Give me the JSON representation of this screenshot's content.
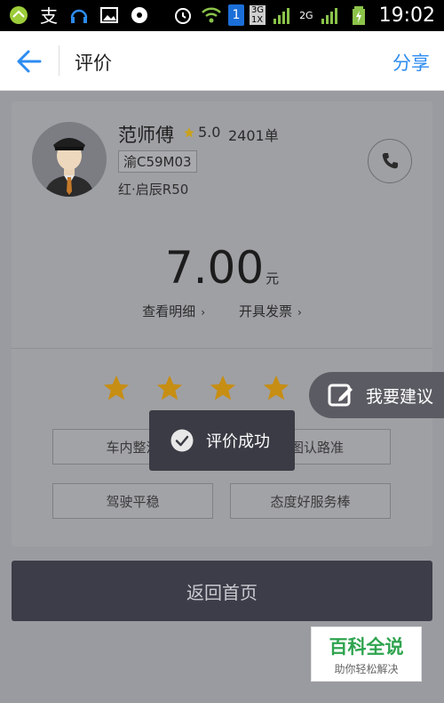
{
  "status_bar": {
    "time": "19:02",
    "sim_badge": "1",
    "network_top": "3G",
    "network_bottom": "1X",
    "network_2g": "2G",
    "icons": [
      "app-icon",
      "alipay-icon",
      "headset-icon",
      "image-icon",
      "disc-icon",
      "alarm-icon",
      "wifi-icon",
      "signal-icon",
      "battery-charging-icon"
    ]
  },
  "header": {
    "title": "评价",
    "share": "分享"
  },
  "driver": {
    "name": "范师傅",
    "rating": "5.0",
    "orders": "2401单",
    "plate": "渝C59M03",
    "car": "红·启辰R50"
  },
  "fare": {
    "amount": "7.00",
    "unit": "元",
    "detail_link": "查看明细",
    "invoice_link": "开具发票"
  },
  "rating_stars": {
    "count": 5,
    "selected": 5,
    "color": "#d49a1a"
  },
  "tags": {
    "t1": "车内整洁",
    "t2": "看图认路准",
    "t3": "驾驶平稳",
    "t4": "态度好服务棒"
  },
  "buttons": {
    "home": "返回首页",
    "suggest": "我要建议"
  },
  "toast": {
    "text": "评价成功"
  },
  "watermark": {
    "title": "百科全说",
    "subtitle": "助你轻松解决"
  },
  "colors": {
    "accent": "#2d8cf0",
    "overlay": "#9e9fa3",
    "toast_bg": "#3a3b44",
    "home_button_bg": "#3c3d48"
  }
}
